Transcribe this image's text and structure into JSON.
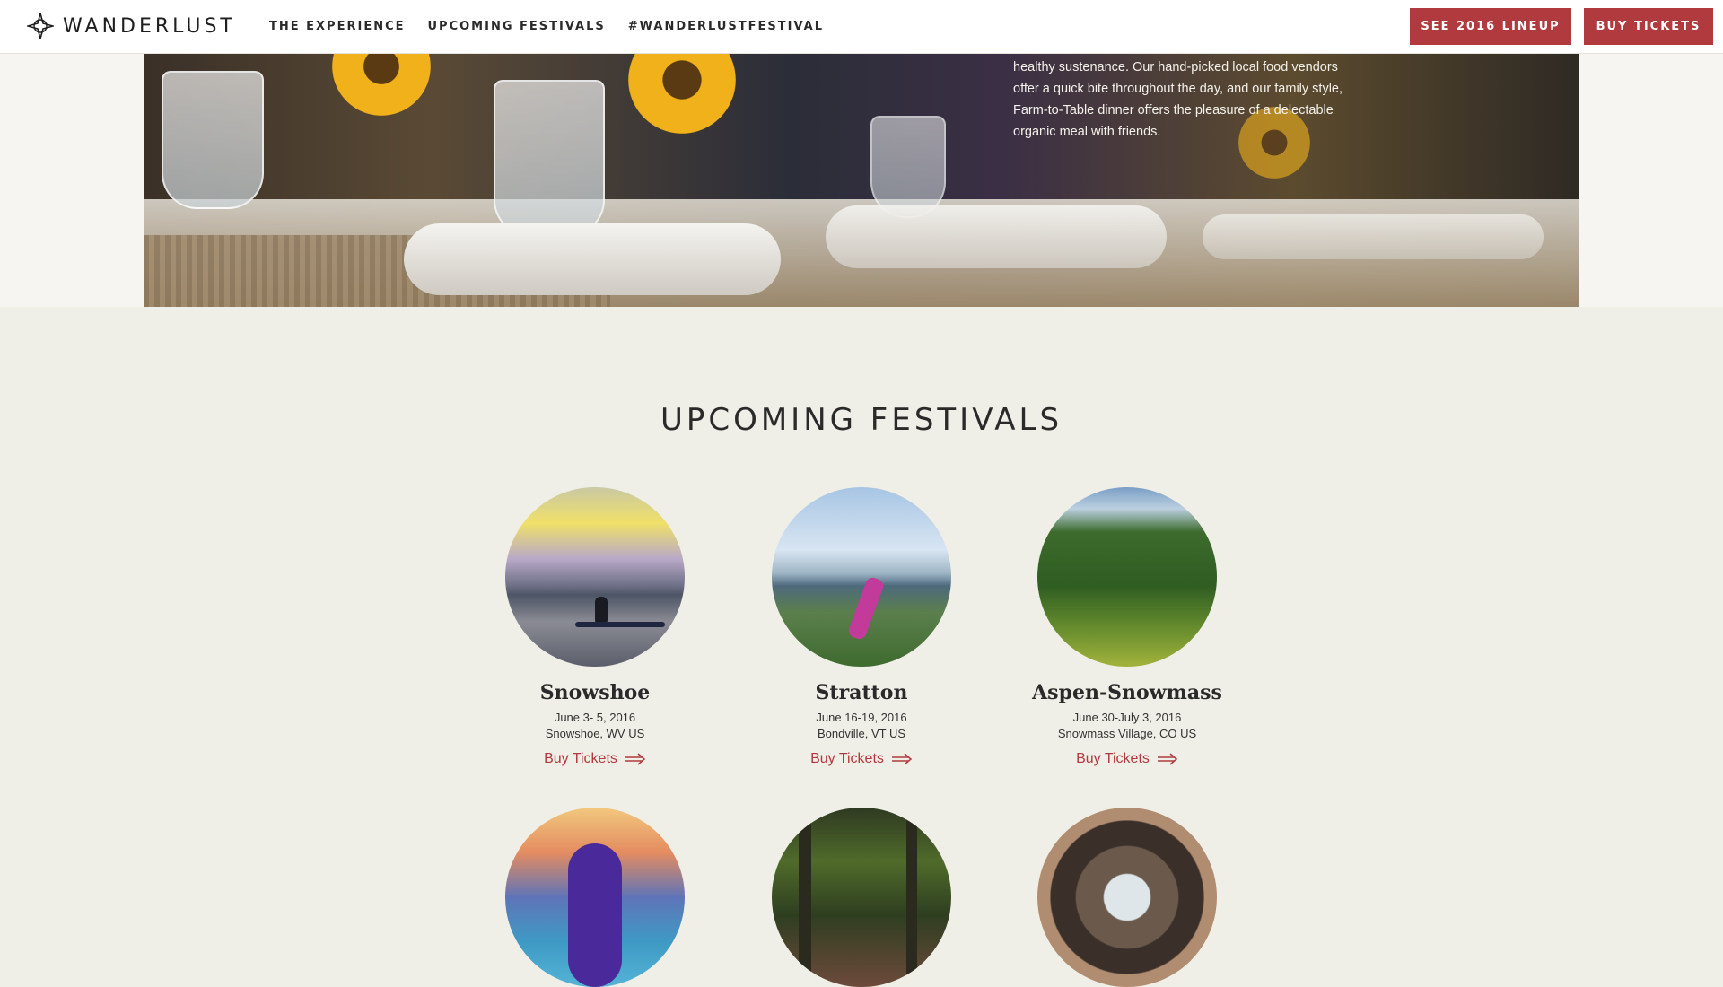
{
  "header": {
    "brand": "WANDERLUST",
    "nav": [
      "THE EXPERIENCE",
      "UPCOMING FESTIVALS",
      "#WANDERLUSTFESTIVAL"
    ],
    "lineup_button": "SEE 2016 LINEUP",
    "tickets_button": "BUY TICKETS"
  },
  "hero": {
    "text_lines": [
      "healthy sustenance. Our hand-picked local food vendors",
      "offer a quick bite throughout the day, and our family style,",
      "Farm-to-Table dinner offers the pleasure of a delectable",
      "organic meal with friends."
    ]
  },
  "festivals": {
    "title": "UPCOMING FESTIVALS",
    "items": [
      {
        "name": "Snowshoe",
        "date": "June 3- 5, 2016",
        "location": "Snowshoe, WV US",
        "cta": "Buy Tickets"
      },
      {
        "name": "Stratton",
        "date": "June 16-19, 2016",
        "location": "Bondville, VT US",
        "cta": "Buy Tickets"
      },
      {
        "name": "Aspen-Snowmass",
        "date": "June 30-July 3, 2016",
        "location": "Snowmass Village, CO US",
        "cta": "Buy Tickets"
      }
    ]
  },
  "colors": {
    "accent": "#b13a3f",
    "page_bg": "#efeee7",
    "header_bg": "#ffffff"
  },
  "icons": [
    "wanderlust-compass-icon",
    "arrow-right-icon"
  ]
}
